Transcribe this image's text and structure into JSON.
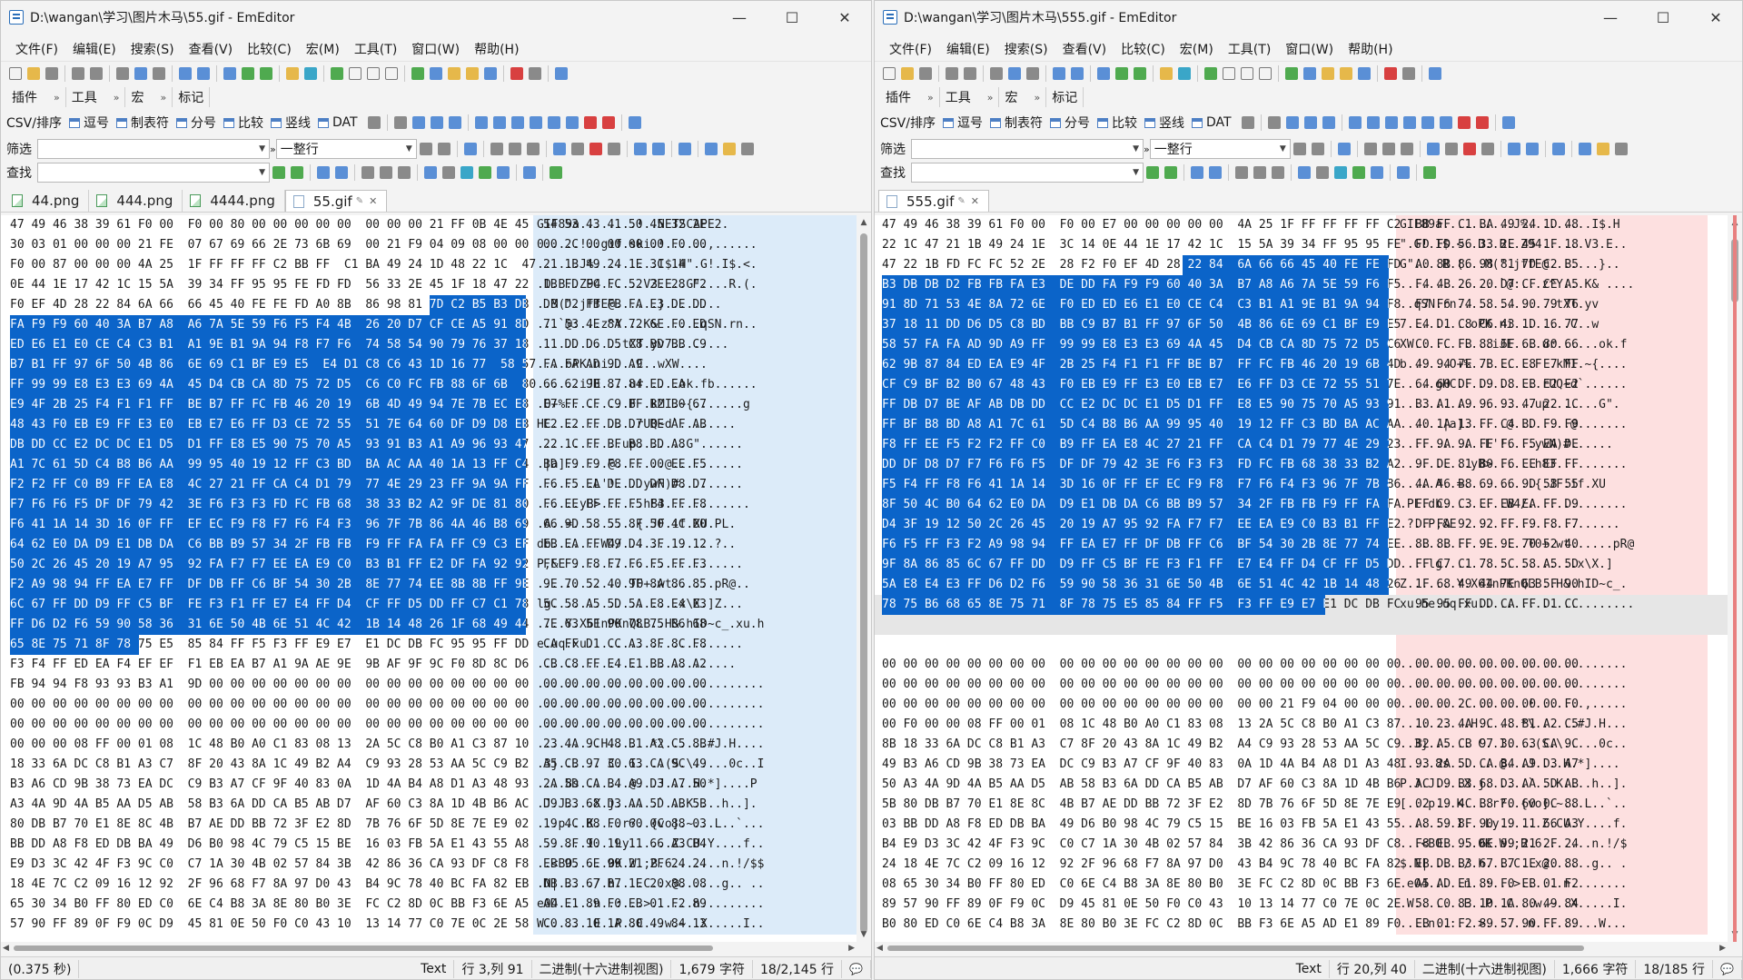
{
  "windows": [
    {
      "title": "D:\\wangan\\学习\\图片木马\\55.gif - EmEditor",
      "menu": [
        "文件(F)",
        "编辑(E)",
        "搜索(S)",
        "查看(V)",
        "比较(C)",
        "宏(M)",
        "工具(T)",
        "窗口(W)",
        "帮助(H)"
      ],
      "toolbar_groups": [
        "插件",
        "工具",
        "宏",
        "标记"
      ],
      "csv_buttons": [
        "CSV/排序",
        "逗号",
        "制表符",
        "分号",
        "比较",
        "竖线",
        "DAT"
      ],
      "filter_label": "筛选",
      "filter_mode": "一整行",
      "find_label": "查找",
      "tabs": [
        "44.png",
        "444.png",
        "4444.png",
        "55.gif"
      ],
      "active_tab": 3,
      "hex_cols": [
        10,
        310,
        590,
        770
      ],
      "selection": {
        "start": [
          4,
          26
        ],
        "end": [
          21,
          8
        ],
        "color": "#0b64c9",
        "light": "#dcebf9"
      },
      "rows": [
        {
          "hex": "47 49 46 38 39 61 F0 00  F0 00 80 00 00 00 00 00  00 00 00 21 FF 0B 4E 45  54 53 43 41 50 45 32 2E",
          "asc": "GIF89a........!..NETSCAPE2."
        },
        {
          "hex": "30 03 01 00 00 00 21 FE  07 67 69 66 2E 73 6B 69  00 21 F9 04 09 08 00 00  00 2C 00 00 00 00 F0 00",
          "asc": "0.....!..gif.ski.!......,......"
        },
        {
          "hex": "F0 00 87 00 00 00 4A 25  1F FF FF FF C2 BB FF  C1 BA 49 24 1D 48 22 1C  47 21 1B 49 24 1E 3C 14",
          "asc": "......J%.........I$.H\".G!.I$.<."
        },
        {
          "hex": "0E 44 1E 17 42 1C 15 5A  39 34 FF 95 95 FE FD FD  56 33 2E 45 1F 18 47 22  1B FD FC FC 52 2E 28 F2",
          "asc": ".D.B..Z94......V3.E..G\"....R.(."
        },
        {
          "hex": "F0 EF 4D 28 22 84 6A 66  66 45 40 FE FE FD A0 8B  86 98 81 7D C2 B5 B3 DB  DB D2 FB FB FA E3 DE DD",
          "asc": "..M(\".jffE@......}........"
        },
        {
          "hex": "FA F9 F9 60 40 3A B7 A8  A6 7A 5E 59 F6 F5 F4 4B  26 20 D7 CF CE A5 91 8D  71 53 4E 8A 72 6E F0 ED",
          "asc": "...`@:...z^Y...K& .....qSN.rn.."
        },
        {
          "hex": "ED E6 E1 E0 CE C4 C3 B1  A1 9E B1 9A 94 F8 F7 F6  74 58 54 90 79 76 37 18  11 DD D6 D5 C8 BD BB C9",
          "asc": "............tXT.yv7........"
        },
        {
          "hex": "B7 B1 FF 97 6F 50 4B 86  6E 69 C1 BF E9 E5  E4 D1 C8 C6 43 1D 16 77  58 57 FA FA AD 9D A9",
          "asc": "....oPK.ni....C..wXW...."
        },
        {
          "hex": "FF 99 99 E8 E3 E3 69 4A  45 D4 CB CA 8D 75 72 D5  C6 C0 FC FB 88 6F 6B  80 66 62 9B 87 84 ED EA",
          "asc": "......iJE....ur.....ok.fb......"
        },
        {
          "hex": "E9 4F 2B 25 F4 F1 F1 FF  BE B7 FF FC FB 46 20 19  6B 4D 49 94 7E 7B EC E8  E7 FF CF C9 BF B2 B0 67",
          "asc": ".O+%.........F .kMI.~{.......g"
        },
        {
          "hex": "48 43 F0 EB E9 FF E3 E0  EB E7 E6 FF D3 CE 72 55  51 7E 64 60 DF D9 D8 EB  E2 E2 FF DB D7 BE AF AB",
          "asc": "HC............rUQ~d`........"
        },
        {
          "hex": "DB DD CC E2 DC DC E1 D5  D1 FF E8 E5 90 75 70 A5  93 91 B3 A1 A9 96 93 47  22 1C FF BF B8 BD A8",
          "asc": "............up.......G\"......"
        },
        {
          "hex": "A1 7C 61 5D C4 B8 B6 AA  99 95 40 19 12 FF C3 BD  BA AC AA 40 1A 13 FF C4  BD F9 F9 F8 FF 00 EE F5",
          "asc": ".|a]......@.......@.........."
        },
        {
          "hex": "F2 F2 FF C0 B9 FF EA E8  4C 27 21 FF CA C4 D1 79  77 4E 29 23 FF 9A 9A FF  F6 F5 EA DE DD DF D8 D7",
          "asc": "........L'!....ywN)#........."
        },
        {
          "hex": "F7 F6 F6 F5 DF DF 79 42  3E F6 F3 F3 FD FC FB 68  38 33 B2 A2 9F DE 81 80  F6 EE EF FF F5 F4 FF F8",
          "asc": "......yB>......h83............"
        },
        {
          "hex": "F6 41 1A 14 3D 16 0F FF  EF EC F9 F8 F7 F6 F4 F3  96 7F 7B 86 4A 46 B8 69  66 9D 58 55 8F 50 4C B0",
          "asc": ".A..=.........{.JF.if.XU.PL."
        },
        {
          "hex": "64 62 E0 DA D9 E1 DB DA  C6 BB B9 57 34 2F FB FB  F9 FF FA FA FF C9 C3 EF  EB EA FF D9 D4 3F 19 12",
          "asc": "db.......W4/.............?.."
        },
        {
          "hex": "50 2C 26 45 20 19 A7 95  92 FA F7 F7 EE EA E9 C0  B3 B1 FF E2 DF FA 92 92  FF F9 F8 F7 F6 F5 FF F3",
          "asc": "P,&E ........................"
        },
        {
          "hex": "F2 A9 98 94 FF EA E7 FF  DF DB FF C6 BF 54 30 2B  8E 77 74 EE 8B 8B FF 9E  9E 70 52 40 9F 8A 86 85",
          "asc": ".............T0+.wt......pR@.."
        },
        {
          "hex": "6C 67 FF DD D9 FF C5 BF  FE F3 F1 FF E7 E4 FF D4  CF FF D5 DD FF C7 C1 78  5C 58 A5 5D 5A E8 E4 E3",
          "asc": "lg..................x\\X.]Z..."
        },
        {
          "hex": "FF D6 D2 F6 59 90 58 36  31 6E 50 4B 6E 51 4C 42  1B 14 48 26 1F 68 49 44  7E 63 5F 90 78 75 B6 68",
          "asc": "....Y.X61nPKnQLB..H&.hID~c_.xu.h"
        },
        {
          "hex": "65 8E 75 71 8F 78 75 E5  85 84 FF F5 F3 FF E9 E7  E1 DC DB FC 95 95 FF DD  CA FF D1 CC A3 8F 8C F8",
          "asc": "e.uq.xu......................"
        },
        {
          "hex": "F3 F4 FF ED EA F4 EF EF  F1 EB EA B7 A1 9A AE 9E  9B AF 9F 9C F0 8D 8C D6  CB C8 FF E4 E1 BB A8 A2",
          "asc": "............................"
        },
        {
          "hex": "FB 94 94 F8 93 93 B3 A1  9D 00 00 00 00 00 00 00  00 00 00 00 00 00 00 00  00 00 00 00 00 00 00 00",
          "asc": "................................"
        },
        {
          "hex": "00 00 00 00 00 00 00 00  00 00 00 00 00 00 00 00  00 00 00 00 00 00 00 00  00 00 00 00 00 00 00 00",
          "asc": "................................"
        },
        {
          "hex": "00 00 00 00 00 00 00 00  00 00 00 00 00 00 00 00  00 00 00 00 00 00 00 00  00 00 00 00 00 00 00 00",
          "asc": "................................"
        },
        {
          "hex": "00 00 00 08 FF 00 01 08  1C 48 B0 A0 C1 83 08 13  2A 5C C8 B0 A1 C3 87 10  23 4A 9C 48 B1 A2 C5 8B",
          "asc": ".........H......*\\......#J.H...."
        },
        {
          "hex": "18 33 6A DC C8 B1 A3 C7  8F 20 43 8A 1C 49 B2 A4  C9 93 28 53 AA 5C C9 B2  A5 CB 97 30 63 CA 9C 49",
          "asc": ".3j...... C..I....(S.\\.....0c..I"
        },
        {
          "hex": "B3 A6 CD 9B 38 73 EA DC  C9 B3 A7 CF 9F 40 83 0A  1D 4A B4 A8 D1 A3 48 93  2A 5D CA B4 A9 D3 A7 50",
          "asc": "....8s.......@...J....H.*]....P"
        },
        {
          "hex": "A3 4A 9D 4A B5 AA D5 AB  58 B3 6A DD CA B5 AB D7  AF 60 C3 8A 1D 4B B6 AC  D9 B3 68 D3 AA 5D AB 5B",
          "asc": ".J.J....X.j......`...K....h..]."
        },
        {
          "hex": "80 DB B7 70 E1 8E 8C 4B  B7 AE DD BB 72 3F E2 8D  7B 76 6F 5D 8E 7E E9 02  19 4C B8 F0 60 0C 88 03",
          "asc": "...p...K....r?..{vo].~...L..`..."
        },
        {
          "hex": "BB DD A8 F8 ED DB BA 49  D6 B0 98 4C 79 C5 15 BE  16 03 FB 5A E1 43 55 A8  59 8F 90 19 11 66 A3 B4",
          "asc": ".......I...Ly......Z.CU.Y....f.."
        },
        {
          "hex": "E9 D3 3C 42 4F F3 9C C0  C7 1A 30 4B 02 57 84 3B  42 86 36 CA 93 DF C8 F8  EB 95 6E 99 21 2F 24 24",
          "asc": "..<BO.....0K.W.;B.6.......n.!/$$"
        },
        {
          "hex": "18 4E 7C C2 09 16 12 92  2F 96 68 F7 8A 97 D0 43  B4 9C 78 40 BC FA 82 EB  DB B3 67 B7 1E 20 88 08",
          "asc": ".N|...../.h....C..x@......g.. .."
        },
        {
          "hex": "65 30 34 B0 FF 80 ED C0  6E C4 B8 3A 8E 80 B0 3E  FC C2 8D 0C BB F3 6E A5  AD E1 89 F0 EB 01 F2 89",
          "asc": "e04.....n..:...>......n........."
        },
        {
          "hex": "57 90 FF 89 0F F9 0C D9  45 81 0E 50 F0 C0 43 10  13 14 77 C0 7E 0C 2E 58  C0 83 10 1A 80 49 84 13",
          "asc": "W.......E..P..C...w.~..X.....I.."
        }
      ],
      "status": [
        "(0.375 秒)",
        "Text",
        "行 3,列 91",
        "二进制(十六进制视图)",
        "1,679 字符",
        "18/2,145 行"
      ]
    },
    {
      "title": "D:\\wangan\\学习\\图片木马\\555.gif - EmEditor",
      "menu": [
        "文件(F)",
        "编辑(E)",
        "搜索(S)",
        "查看(V)",
        "比较(C)",
        "宏(M)",
        "工具(T)",
        "窗口(W)",
        "帮助(H)"
      ],
      "toolbar_groups": [
        "插件",
        "工具",
        "宏",
        "标记"
      ],
      "csv_buttons": [
        "CSV/排序",
        "逗号",
        "制表符",
        "分号",
        "比较",
        "竖线",
        "DAT"
      ],
      "filter_label": "筛选",
      "filter_mode": "一整行",
      "find_label": "查找",
      "tabs": [
        "555.gif"
      ],
      "active_tab": 0,
      "hex_cols": [
        8,
        306,
        578,
        717
      ],
      "selection": {
        "start": [
          2,
          19
        ],
        "end": [
          19,
          28
        ],
        "color": "#0b64c9",
        "light": "#fde0e0"
      },
      "gray_rows": [
        19,
        20
      ],
      "rows": [
        {
          "hex": "47 49 46 38 39 61 F0 00  F0 00 E7 00 00 00 00 00  4A 25 1F FF FF FF FF C2  BB FF C1 BA 49 24 1D 48",
          "asc": "GIF89a..........J%.........I$.H"
        },
        {
          "hex": "22 1C 47 21 1B 49 24 1E  3C 14 0E 44 1E 17 42 1C  15 5A 39 34 FF 95 95 FE  FD FD 56 33 2E 45 1F 18",
          "asc": "\".G!.I$.<..D..B..Z94......V3.E.."
        },
        {
          "hex": "47 22 1B FD FC FC 52 2E  28 F2 F0 EF 4D 28 22 84  6A 66 66 45 40 FE FE FD  A0 8B 86 98 81 7D C2 B5",
          "asc": "G\"....R.(...M(\".jffE@.......}.."
        },
        {
          "hex": "B3 DB DB D2 FB FB FA E3  DE DD FA F9 F9 60 40 3A  B7 A8 A6 7A 5E 59 F6 F5  F4 4B 26 20 D7 CF CE A5",
          "asc": "..............`@:...z^Y...K& ...."
        },
        {
          "hex": "91 8D 71 53 4E 8A 72 6E  F0 ED ED E6 E1 E0 CE C4  C3 B1 A1 9E B1 9A 94 F8  F7 F6 74 58 54 90 79 76",
          "asc": "..qSN.rn..............tXT.yv"
        },
        {
          "hex": "37 18 11 DD D6 D5 C8 BD  BB C9 B7 B1 FF 97 6F 50  4B 86 6E 69 C1 BF E9 E5  E4 D1 C8 C6 43 1D 16 77",
          "asc": "7.........oPK.ni........C..w"
        },
        {
          "hex": "58 57 FA FA AD 9D A9 FF  99 99 E8 E3 E3 69 4A 45  D4 CB CA 8D 75 72 D5 C6  C0 FC FB 88 6F 6B 80 66",
          "asc": "XW...........iJE....ur......ok.f"
        },
        {
          "hex": "62 9B 87 84 ED EA E9 4F  2B 25 F4 F1 F1 FF BE B7  FF FC FB 46 20 19 6B 4D  49 94 7E 7B EC E8 E7 FF",
          "asc": "b......O+%.........F .kMI.~{...."
        },
        {
          "hex": "CF C9 BF B2 B0 67 48 43  F0 EB E9 FF E3 E0 EB E7  E6 FF D3 CE 72 55 51 7E  64 60 DF D9 D8 EB E2 E2",
          "asc": ".....gHC............rUQ~d`......"
        },
        {
          "hex": "FF DB D7 BE AF AB DB DD  CC E2 DC DC E1 D5 D1 FF  E8 E5 90 75 70 A5 93 91  B3 A1 A9 96 93 47 22 1C",
          "asc": "...................up.......G\"."
        },
        {
          "hex": "FF BF B8 BD A8 A1 7C 61  5D C4 B8 B6 AA 99 95 40  19 12 FF C3 BD BA AC AA  40 1A 13 FF C4 BD F9 F9",
          "asc": "......|a]......@........@......."
        },
        {
          "hex": "F8 FF EE F5 F2 F2 FF C0  B9 FF EA E8 4C 27 21 FF  CA C4 D1 79 77 4E 29 23  FF 9A 9A FF F6 F5 EA DE",
          "asc": "............L'!....ywN)#......"
        },
        {
          "hex": "DD DF D8 D7 F7 F6 F6 F5  DF DF 79 42 3E F6 F3 F3  FD FC FB 68 38 33 B2 A2  9F DE 81 80 F6 EE EF FF",
          "asc": "..........yB>......h83.........."
        },
        {
          "hex": "F5 F4 FF F8 F6 41 1A 14  3D 16 0F FF EF EC F9 F8  F7 F6 F4 F3 96 7F 7B 86  4A 46 B8 69 66 9D 58 55",
          "asc": ".....A..=..........{.JF.if.XU"
        },
        {
          "hex": "8F 50 4C B0 64 62 E0 DA  D9 E1 DB DA C6 BB B9 57  34 2F FB FB F9 FF FA FA  FF C9 C3 EF EB EA FF D9",
          "asc": ".PL.db.........W4/.............."
        },
        {
          "hex": "D4 3F 19 12 50 2C 26 45  20 19 A7 95 92 FA F7 F7  EE EA E9 C0 B3 B1 FF E2  DF FA 92 92 FF F9 F8 F7",
          "asc": ".?..P,&E ......................"
        },
        {
          "hex": "F6 F5 FF F3 F2 A9 98 94  FF EA E7 FF DF DB FF C6  BF 54 30 2B 8E 77 74 EE  8B 8B FF 9E 9E 70 52 40",
          "asc": "..................T0+.wt......pR@"
        },
        {
          "hex": "9F 8A 86 85 6C 67 FF DD  D9 FF C5 BF FE F3 F1 FF  E7 E4 FF D4 CF FF D5 DD  FF C7 C1 78 5C 58 A5 5D",
          "asc": "....lg...................x\\X.]"
        },
        {
          "hex": "5A E8 E4 E3 FF D6 D2 F6  59 90 58 36 31 6E 50 4B  6E 51 4C 42 1B 14 48 26  1F 68 49 44 7E 63 5F 90",
          "asc": "Z.......Y.X61nPKnQLB..H&.hID~c_."
        },
        {
          "hex": "78 75 B6 68 65 8E 75 71  8F 78 75 E5 85 84 FF F5  F3 FF E9 E7 E1 DC DB FC  95 95 FF DD CA FF D1 CC",
          "asc": "xu.he.uq.xu......................"
        },
        {
          "hex": "",
          "asc": ""
        },
        {
          "hex": "",
          "asc": ""
        },
        {
          "hex": "00 00 00 00 00 00 00 00  00 00 00 00 00 00 00 00  00 00 00 00 00 00 00 00  00 00 00 00 00 00 00 00",
          "asc": "................................"
        },
        {
          "hex": "00 00 00 00 00 00 00 00  00 00 00 00 00 00 00 00  00 00 00 00 00 00 00 00  00 00 00 00 00 00 00 00",
          "asc": "................................"
        },
        {
          "hex": "00 00 00 00 00 00 00 00  00 00 00 00 00 00 00 00  00 00 21 F9 04 00 00 00  00 00 2C 00 00 00 00 F0",
          "asc": "..................!.......,....."
        },
        {
          "hex": "00 F0 00 00 08 FF 00 01  08 1C 48 B0 A0 C1 83 08  13 2A 5C C8 B0 A1 C3 87  10 23 4A 9C 48 B1 A2 C5",
          "asc": "..........H......*\\......#J.H..."
        },
        {
          "hex": "8B 18 33 6A DC C8 B1 A3  C7 8F 20 43 8A 1C 49 B2  A4 C9 93 28 53 AA 5C C9  B2 A5 CB 97 30 63 CA 9C",
          "asc": "..3j...... C..I....(S.\\.....0c.."
        },
        {
          "hex": "49 B3 A6 CD 9B 38 73 EA  DC C9 B3 A7 CF 9F 40 83  0A 1D 4A B4 A8 D1 A3 48  93 2A 5D CA B4 A9 D3 A7",
          "asc": "I....8s.......@...J....H.*]...."
        },
        {
          "hex": "50 A3 4A 9D 4A B5 AA D5  AB 58 B3 6A DD CA B5 AB  D7 AF 60 C3 8A 1D 4B B6  AC D9 B3 68 D3 AA 5D AB",
          "asc": "P.J.J....X.j......`...K....h..]."
        },
        {
          "hex": "5B 80 DB B7 70 E1 8E 8C  4B B7 AE DD BB 72 3F E2  8D 7B 76 6F 5D 8E 7E E9  02 19 4C B8 F0 60 0C 88",
          "asc": "[...p...K....r?..{vo].~...L..`.."
        },
        {
          "hex": "03 BB DD A8 F8 ED DB BA  49 D6 B0 98 4C 79 C5 15  BE 16 03 FB 5A E1 43 55  A8 59 8F 90 19 11 66 A3",
          "asc": "........I...Ly......Z.CU.Y....f."
        },
        {
          "hex": "B4 E9 D3 3C 42 4F F3 9C  C0 C7 1A 30 4B 02 57 84  3B 42 86 36 CA 93 DF C8  F8 EB 95 6E 99 21 2F 24",
          "asc": "...<BO.....0K.W.;B.6.......n.!/$"
        },
        {
          "hex": "24 18 4E 7C C2 09 16 12  92 2F 96 68 F7 8A 97 D0  43 B4 9C 78 40 BC FA 82  EB DB B3 67 B7 1E 20 88",
          "asc": "$.N|...../.h....C..x@......g.. ."
        },
        {
          "hex": "08 65 30 34 B0 FF 80 ED  C0 6E C4 B8 3A 8E 80 B0  3E FC C2 8D 0C BB F3 6E  A5 AD E1 89 F0 EB 01 F2",
          "asc": ".e04.....n..:...>......n........"
        },
        {
          "hex": "89 57 90 FF 89 0F F9 0C  D9 45 81 0E 50 F0 C0 43  10 13 14 77 C0 7E 0C 2E  58 C0 83 10 1A 80 49 84",
          "asc": ".W.......E..P..C...w.~..X.....I."
        },
        {
          "hex": "B0 80 ED C0 6E C4 B8 3A  8E 80 B0 3E FC C2 8D 0C  BB F3 6E A5 AD E1 89 F0  EB 01 F2 89 57 90 FF 89",
          "asc": "....n..:...>......n.........W..."
        }
      ],
      "status": [
        "Text",
        "行 20,列 40",
        "二进制(十六进制视图)",
        "1,666 字符",
        "18/185 行"
      ]
    }
  ]
}
